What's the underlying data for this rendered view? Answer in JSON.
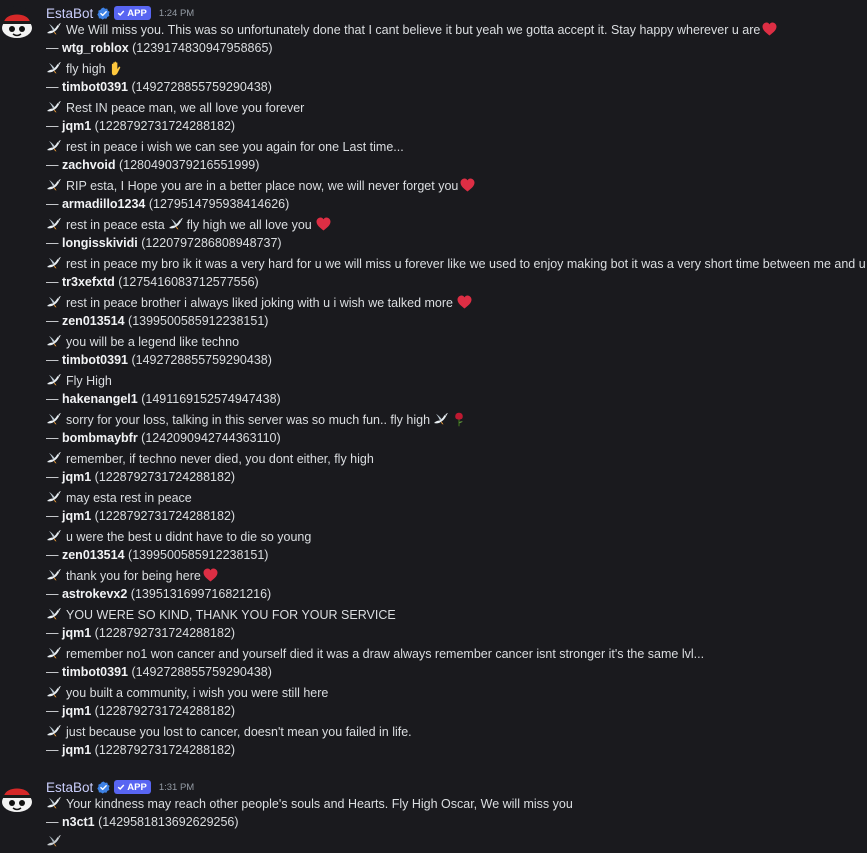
{
  "group1": {
    "author": "EstaBot",
    "badge": "APP",
    "time": "1:24 PM",
    "messages": [
      {
        "text": "We Will miss you. This was so unfortunately done that I cant believe it but yeah we gotta accept it. Stay happy wherever u are",
        "user": "wtg_roblox",
        "id": "(1239174830947958865)"
      },
      {
        "text": "fly high",
        "user": "timbot0391",
        "id": "(1492728855759290438)"
      },
      {
        "text": "Rest IN peace man, we all love you forever",
        "user": "jqm1",
        "id": "(1228792731724288182)"
      },
      {
        "text": "rest in peace i wish we can see you again for one Last time...",
        "user": "zachvoid",
        "id": "(1280490379216551999)"
      },
      {
        "text": "RIP esta, I Hope you are in a better place now, we will never forget you",
        "user": "armadillo1234",
        "id": "(1279514795938414626)"
      },
      {
        "text": "rest in peace esta",
        "text2": "fly high we all love you",
        "user": "longisskividi",
        "id": "(1220797286808948737)"
      },
      {
        "text": "rest in peace my bro ik it was a very hard for u we will miss u forever like we used to enjoy making bot it was a very short time between me and u",
        "user": "tr3xefxtd",
        "id": "(1275416083712577556)"
      },
      {
        "text": "rest in peace brother i always liked joking with u i wish we talked more",
        "user": "zen013514",
        "id": "(1399500585912238151)"
      },
      {
        "text": "you will be a legend like techno",
        "user": "timbot0391",
        "id": "(1492728855759290438)"
      },
      {
        "text": "Fly High",
        "user": "hakenangel1",
        "id": "(1491169152574947438)"
      },
      {
        "text": "sorry for your loss, talking in this server was so much fun.. fly high",
        "user": "bombmaybfr",
        "id": "(1242090942744363110)"
      },
      {
        "text": "remember, if techno never died, you dont either, fly high",
        "user": "jqm1",
        "id": "(1228792731724288182)"
      },
      {
        "text": "may esta rest in peace",
        "user": "jqm1",
        "id": "(1228792731724288182)"
      },
      {
        "text": "u were the best u didnt have to die so young",
        "user": "zen013514",
        "id": "(1399500585912238151)"
      },
      {
        "text": "thank you for being here",
        "user": "astrokevx2",
        "id": "(1395131699716821216)"
      },
      {
        "text": "YOU WERE SO KIND, THANK YOU FOR YOUR SERVICE",
        "user": "jqm1",
        "id": "(1228792731724288182)"
      },
      {
        "text": "remember no1 won cancer and yourself died it was a draw always remember cancer isnt stronger it's the same lvl...",
        "user": "timbot0391",
        "id": "(1492728855759290438)"
      },
      {
        "text": "you built a community, i wish you were still here",
        "user": "jqm1",
        "id": "(1228792731724288182)"
      },
      {
        "text": "just because you lost to cancer, doesn't mean you failed in life.",
        "user": "jqm1",
        "id": "(1228792731724288182)"
      }
    ]
  },
  "group2": {
    "author": "EstaBot",
    "badge": "APP",
    "time": "1:31 PM",
    "messages": [
      {
        "text": "Your kindness may reach other people's souls and Hearts. Fly High Oscar, We will miss you",
        "user": "n3ct1",
        "id": "(1429581813692629256)"
      }
    ]
  },
  "dash": "—"
}
